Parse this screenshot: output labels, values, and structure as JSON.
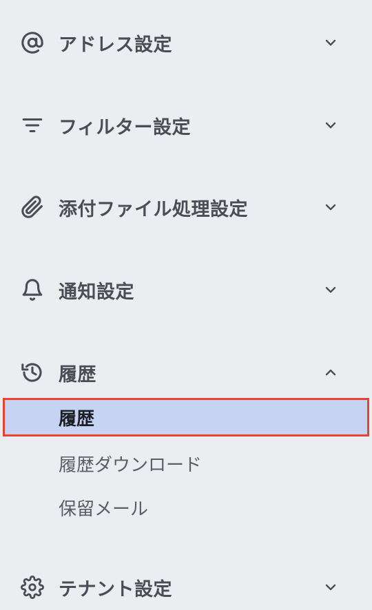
{
  "sections": {
    "address": {
      "label": "アドレス設定",
      "icon": "at-icon",
      "expanded": false
    },
    "filter": {
      "label": "フィルター設定",
      "icon": "filter-icon",
      "expanded": false
    },
    "attachment": {
      "label": "添付ファイル処理設定",
      "icon": "paperclip-icon",
      "expanded": false
    },
    "notification": {
      "label": "通知設定",
      "icon": "bell-icon",
      "expanded": false
    },
    "history": {
      "label": "履歴",
      "icon": "history-icon",
      "expanded": true,
      "items": [
        {
          "label": "履歴",
          "active": true
        },
        {
          "label": "履歴ダウンロード",
          "active": false
        },
        {
          "label": "保留メール",
          "active": false
        }
      ]
    },
    "tenant": {
      "label": "テナント設定",
      "icon": "gear-icon",
      "expanded": false
    }
  },
  "colors": {
    "background": "#ecedf1",
    "active_bg": "#c7d3f2",
    "highlight_border": "#e8432f",
    "text_primary": "#4a4d55"
  }
}
